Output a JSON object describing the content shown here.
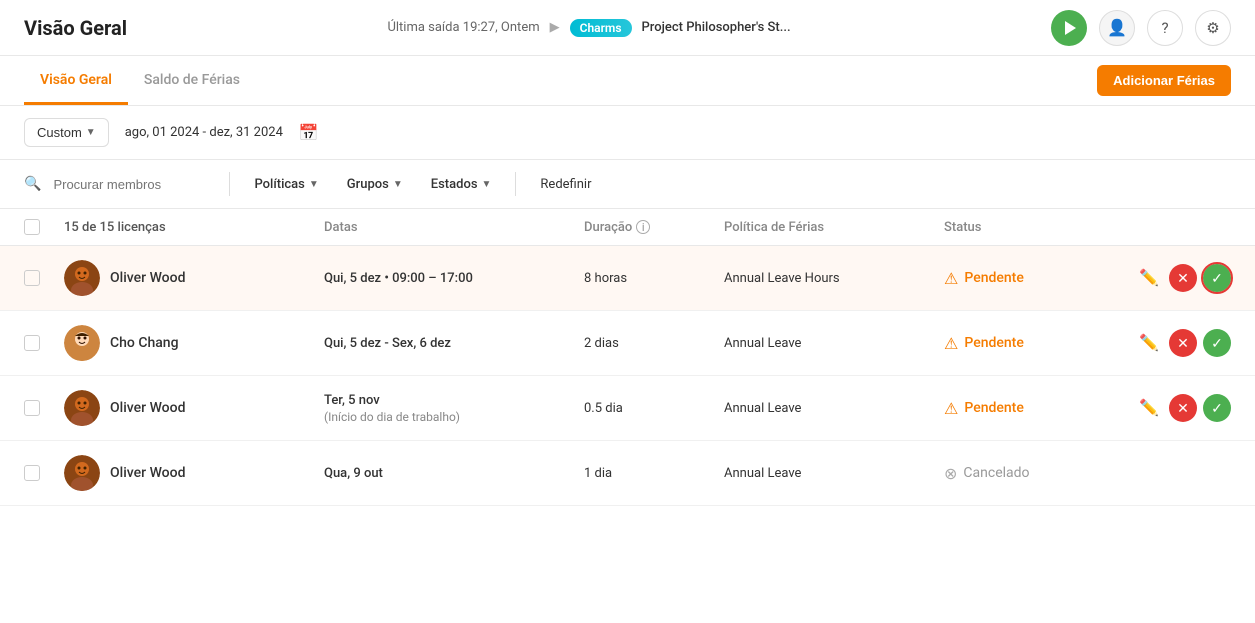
{
  "header": {
    "title": "Visão Geral",
    "last_exit": "Última saída 19:27, Ontem",
    "tag": "Charms",
    "project": "Project Philosopher's St...",
    "user_icon": "👤",
    "help_icon": "?",
    "settings_icon": "⚙"
  },
  "tabs": {
    "tab1": "Visão Geral",
    "tab2": "Saldo de Férias",
    "add_button": "Adicionar Férias"
  },
  "toolbar": {
    "custom_label": "Custom",
    "date_range": "ago, 01 2024 - dez, 31 2024"
  },
  "filters": {
    "search_placeholder": "Procurar membros",
    "policies": "Políticas",
    "groups": "Grupos",
    "states": "Estados",
    "reset": "Redefinir"
  },
  "table": {
    "col_licenses": "15 de 15 licenças",
    "col_dates": "Datas",
    "col_duration": "Duração",
    "col_policy": "Política de Férias",
    "col_status": "Status",
    "rows": [
      {
        "id": 1,
        "member": "Oliver Wood",
        "avatar_type": "oliver",
        "dates": "Qui, 5 dez • 09:00 – 17:00",
        "dates_sub": "",
        "duration": "8 horas",
        "policy": "Annual Leave Hours",
        "status": "Pendente",
        "status_type": "pending",
        "highlighted": true
      },
      {
        "id": 2,
        "member": "Cho Chang",
        "avatar_type": "cho",
        "dates": "Qui, 5 dez - Sex, 6 dez",
        "dates_sub": "",
        "duration": "2 dias",
        "policy": "Annual Leave",
        "status": "Pendente",
        "status_type": "pending",
        "highlighted": false
      },
      {
        "id": 3,
        "member": "Oliver Wood",
        "avatar_type": "oliver",
        "dates": "Ter, 5 nov",
        "dates_sub": "(Início do dia de trabalho)",
        "duration": "0.5 dia",
        "policy": "Annual Leave",
        "status": "Pendente",
        "status_type": "pending",
        "highlighted": false
      },
      {
        "id": 4,
        "member": "Oliver Wood",
        "avatar_type": "oliver",
        "dates": "Qua, 9 out",
        "dates_sub": "",
        "duration": "1 dia",
        "policy": "Annual Leave",
        "status": "Cancelado",
        "status_type": "cancelled",
        "highlighted": false
      }
    ]
  }
}
